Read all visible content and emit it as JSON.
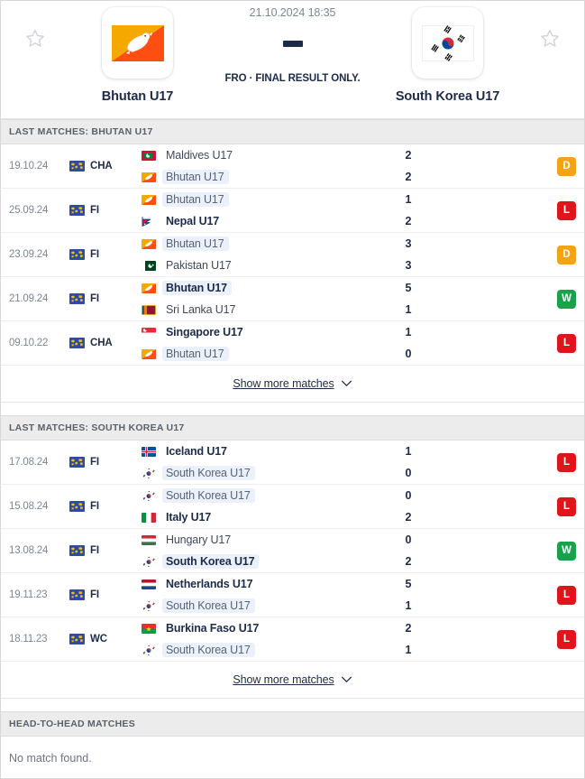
{
  "header": {
    "datetime": "21.10.2024 18:35",
    "status": "FRO · FINAL RESULT ONLY.",
    "score_placeholder": "—",
    "home": {
      "name": "Bhutan U17",
      "flag": "bhutan-flag",
      "star": "star-icon"
    },
    "away": {
      "name": "South Korea U17",
      "flag": "south-korea-flag",
      "star": "star-icon"
    }
  },
  "sections": [
    {
      "title": "LAST MATCHES: BHUTAN U17",
      "show_more_label": "Show more matches",
      "matches": [
        {
          "date": "19.10.24",
          "competition": "CHA",
          "result": "D",
          "home": {
            "name": "Maldives U17",
            "flag": "maldives",
            "bold": false,
            "highlight": false,
            "score": "2"
          },
          "away": {
            "name": "Bhutan U17",
            "flag": "bhutan",
            "bold": false,
            "highlight": true,
            "score": "2"
          }
        },
        {
          "date": "25.09.24",
          "competition": "FI",
          "result": "L",
          "home": {
            "name": "Bhutan U17",
            "flag": "bhutan",
            "bold": false,
            "highlight": true,
            "score": "1"
          },
          "away": {
            "name": "Nepal U17",
            "flag": "nepal",
            "bold": true,
            "highlight": false,
            "score": "2"
          }
        },
        {
          "date": "23.09.24",
          "competition": "FI",
          "result": "D",
          "home": {
            "name": "Bhutan U17",
            "flag": "bhutan",
            "bold": false,
            "highlight": true,
            "score": "3"
          },
          "away": {
            "name": "Pakistan U17",
            "flag": "pakistan",
            "bold": false,
            "highlight": false,
            "score": "3"
          }
        },
        {
          "date": "21.09.24",
          "competition": "FI",
          "result": "W",
          "home": {
            "name": "Bhutan U17",
            "flag": "bhutan",
            "bold": true,
            "highlight": true,
            "score": "5"
          },
          "away": {
            "name": "Sri Lanka U17",
            "flag": "srilanka",
            "bold": false,
            "highlight": false,
            "score": "1"
          }
        },
        {
          "date": "09.10.22",
          "competition": "CHA",
          "result": "L",
          "home": {
            "name": "Singapore U17",
            "flag": "singapore",
            "bold": true,
            "highlight": false,
            "score": "1"
          },
          "away": {
            "name": "Bhutan U17",
            "flag": "bhutan",
            "bold": false,
            "highlight": true,
            "score": "0"
          }
        }
      ]
    },
    {
      "title": "LAST MATCHES: SOUTH KOREA U17",
      "show_more_label": "Show more matches",
      "matches": [
        {
          "date": "17.08.24",
          "competition": "FI",
          "result": "L",
          "home": {
            "name": "Iceland U17",
            "flag": "iceland",
            "bold": true,
            "highlight": false,
            "score": "1"
          },
          "away": {
            "name": "South Korea U17",
            "flag": "southkorea",
            "bold": false,
            "highlight": true,
            "score": "0"
          }
        },
        {
          "date": "15.08.24",
          "competition": "FI",
          "result": "L",
          "home": {
            "name": "South Korea U17",
            "flag": "southkorea",
            "bold": false,
            "highlight": true,
            "score": "0"
          },
          "away": {
            "name": "Italy U17",
            "flag": "italy",
            "bold": true,
            "highlight": false,
            "score": "2"
          }
        },
        {
          "date": "13.08.24",
          "competition": "FI",
          "result": "W",
          "home": {
            "name": "Hungary U17",
            "flag": "hungary",
            "bold": false,
            "highlight": false,
            "score": "0"
          },
          "away": {
            "name": "South Korea U17",
            "flag": "southkorea",
            "bold": true,
            "highlight": true,
            "score": "2"
          }
        },
        {
          "date": "19.11.23",
          "competition": "FI",
          "result": "L",
          "home": {
            "name": "Netherlands U17",
            "flag": "netherlands",
            "bold": true,
            "highlight": false,
            "score": "5"
          },
          "away": {
            "name": "South Korea U17",
            "flag": "southkorea",
            "bold": false,
            "highlight": true,
            "score": "1"
          }
        },
        {
          "date": "18.11.23",
          "competition": "WC",
          "result": "L",
          "home": {
            "name": "Burkina Faso U17",
            "flag": "burkinafaso",
            "bold": true,
            "highlight": false,
            "score": "2"
          },
          "away": {
            "name": "South Korea U17",
            "flag": "southkorea",
            "bold": false,
            "highlight": true,
            "score": "1"
          }
        }
      ]
    }
  ],
  "h2h": {
    "title": "HEAD-TO-HEAD MATCHES",
    "empty_text": "No match found."
  },
  "colors": {
    "win": "#16a34a",
    "draw": "#f2a414",
    "loss": "#e0141b",
    "text_primary": "#1c2b4a",
    "text_muted": "#7b8794",
    "highlight_bg": "#eaf1fb",
    "section_bg": "#ececec"
  }
}
